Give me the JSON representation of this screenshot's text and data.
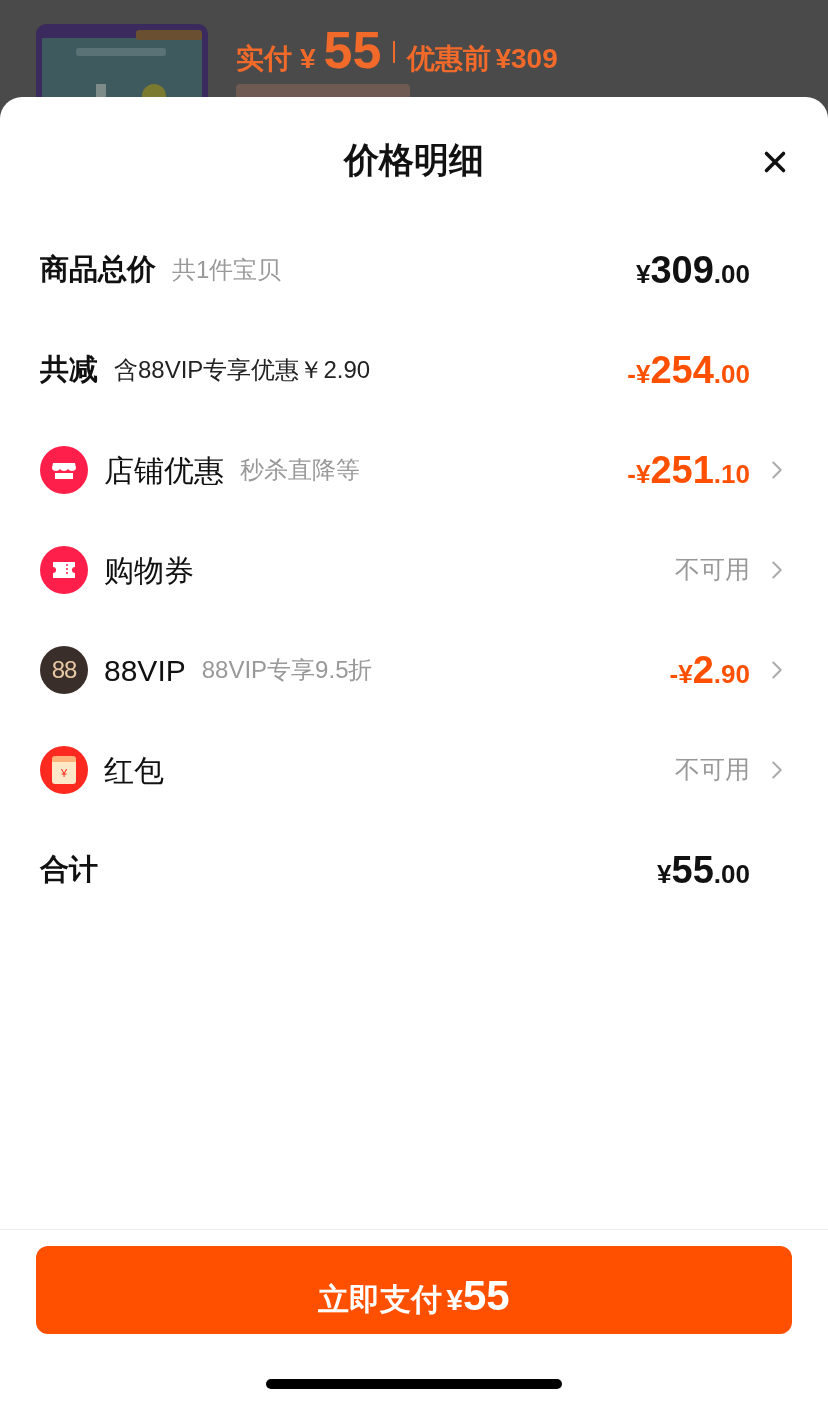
{
  "background_page": {
    "price_label": "实付",
    "price_currency": "¥",
    "price": "55",
    "original_label": "优惠前",
    "original_price": "¥309"
  },
  "sheet": {
    "title": "价格明细"
  },
  "rows": [
    {
      "kind": "summary",
      "label": "商品总价",
      "note": "共1件宝贝",
      "note_emphasis": false,
      "discount": false,
      "link": false,
      "amount": {
        "currency": "¥",
        "integer": "309",
        "decimal": ".00"
      }
    },
    {
      "kind": "summary",
      "label": "共减",
      "note": "含88VIP专享优惠￥2.90",
      "note_emphasis": true,
      "discount": true,
      "link": false,
      "amount": {
        "currency": "-¥",
        "integer": "254",
        "decimal": ".00"
      }
    },
    {
      "kind": "shop",
      "label": "店铺优惠",
      "note": "秒杀直降等",
      "note_emphasis": false,
      "discount": true,
      "link": true,
      "amount": {
        "currency": "-¥",
        "integer": "251",
        "decimal": ".10"
      }
    },
    {
      "kind": "coupon",
      "label": "购物券",
      "link": true,
      "status": "不可用"
    },
    {
      "kind": "vip",
      "badge": "88",
      "label": "88VIP",
      "note": "88VIP专享9.5折",
      "note_emphasis": false,
      "discount": true,
      "link": true,
      "amount": {
        "currency": "-¥",
        "integer": "2",
        "decimal": ".90"
      }
    },
    {
      "kind": "envelope",
      "badge": "¥",
      "label": "红包",
      "link": true,
      "status": "不可用"
    },
    {
      "kind": "summary",
      "label": "合计",
      "discount": false,
      "link": false,
      "amount": {
        "currency": "¥",
        "integer": "55",
        "decimal": ".00"
      }
    }
  ],
  "pay_button": {
    "label": "立即支付",
    "currency": "¥",
    "amount": "55"
  }
}
